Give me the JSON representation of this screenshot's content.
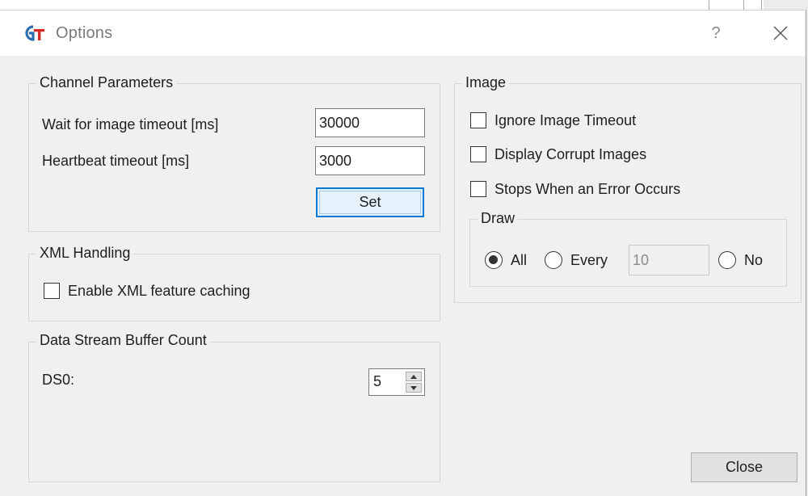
{
  "window": {
    "title": "Options",
    "help_label": "?"
  },
  "channel_parameters": {
    "title": "Channel Parameters",
    "wait_label": "Wait for image timeout [ms]",
    "wait_value": "30000",
    "heartbeat_label": "Heartbeat timeout [ms]",
    "heartbeat_value": "3000",
    "set_label": "Set"
  },
  "xml_handling": {
    "title": "XML Handling",
    "enable_caching_label": "Enable XML feature caching",
    "enable_caching_checked": false
  },
  "data_stream": {
    "title": "Data Stream Buffer Count",
    "ds0_label": "DS0:",
    "ds0_value": "5"
  },
  "image": {
    "title": "Image",
    "ignore_timeout_label": "Ignore Image Timeout",
    "ignore_timeout_checked": false,
    "display_corrupt_label": "Display Corrupt Images",
    "display_corrupt_checked": false,
    "stops_on_error_label": "Stops When an Error Occurs",
    "stops_on_error_checked": false,
    "draw": {
      "title": "Draw",
      "selected": "All",
      "option_all": "All",
      "option_every": "Every",
      "every_value": "10",
      "option_no": "No"
    }
  },
  "footer": {
    "close_label": "Close"
  },
  "colors": {
    "accent": "#0078d7",
    "dialog_bg": "#f0f0f0",
    "titlebar_bg": "#ffffff"
  },
  "icons": {
    "app": "gt-logo-icon",
    "help": "help-icon",
    "close": "close-icon",
    "spin_up": "spin-up-icon",
    "spin_down": "spin-down-icon"
  }
}
